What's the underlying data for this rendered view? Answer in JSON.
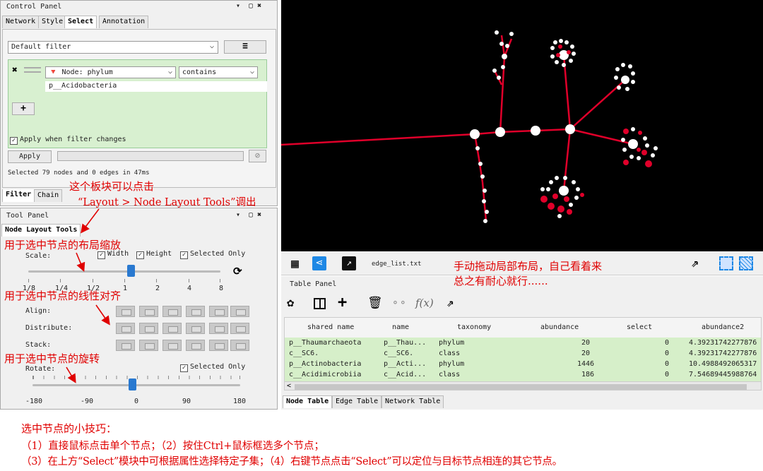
{
  "control_panel": {
    "title": "Control Panel",
    "tabs": [
      "Network",
      "Style",
      "Select",
      "Annotation"
    ],
    "filter_select": "Default filter",
    "node_field": "Node: phylum",
    "condition": "contains",
    "filter_value": "p__Acidobacteria",
    "apply_when_changes": "Apply when filter changes",
    "apply_label": "Apply",
    "status": "Selected 79 nodes and 0 edges in 47ms",
    "bottom_tabs": [
      "Filter",
      "Chain"
    ]
  },
  "tool_panel": {
    "title": "Tool Panel",
    "tab": "Node Layout Tools",
    "scale_label": "Scale:",
    "width_label": "Width",
    "height_label": "Height",
    "selected_only": "Selected Only",
    "scale_ticks": [
      "1/8",
      "1/4",
      "1/2",
      "1",
      "2",
      "4",
      "8"
    ],
    "scale_value": 1,
    "align_label": "Align:",
    "distribute_label": "Distribute:",
    "stack_label": "Stack:",
    "rotate_label": "Rotate:",
    "rotate_selected_only": "Selected Only",
    "rotate_ticks": [
      "-180",
      "-90",
      "0",
      "90",
      "180"
    ],
    "rotate_value": 0
  },
  "annotations": {
    "a1_line1": "这个板块可以点击",
    "a1_line2": "“Layout > Node Layout Tools”调出",
    "a2": "用于选中节点的布局缩放",
    "a3": "用于选中节点的线性对齐",
    "a4": "用于选中节点的旋转",
    "a5_line1": "手动拖动局部布局，自己看着来",
    "a5_line2": "总之有耐心就行......"
  },
  "toolbar": {
    "filename": "edge_list.txt"
  },
  "table_panel": {
    "title": "Table Panel",
    "fx": "f(x)",
    "columns": [
      "shared name",
      "name",
      "taxonomy",
      "abundance",
      "select",
      "abundance2"
    ],
    "rows": [
      [
        "p__Thaumarchaeota",
        "p__Thau...",
        "phylum",
        "20",
        "0",
        "4.39231742277876"
      ],
      [
        "c__SC6.",
        "c__SC6.",
        "class",
        "20",
        "0",
        "4.39231742277876"
      ],
      [
        "p__Actinobacteria",
        "p__Acti...",
        "phylum",
        "1446",
        "0",
        "10.4988492065317"
      ],
      [
        "c__Acidimicrobiia",
        "c__Acid...",
        "class",
        "186",
        "0",
        "7.54689445988764"
      ]
    ],
    "bottom_tabs": [
      "Node Table",
      "Edge Table",
      "Network Table"
    ]
  },
  "tips": {
    "title": "选中节点的小技巧：",
    "line1": "（1）直接鼠标点击单个节点；（2）按住Ctrl+鼠标框选多个节点；",
    "line2": "（3）在上方“Select”模块中可根据属性选择特定子集；（4）右键节点点击“Select”可以定位与目标节点相连的其它节点。"
  },
  "colors": {
    "annotation": "#e00000",
    "filter_bg": "#d8f0d0",
    "network_bg": "#000000",
    "edge": "#e0002a",
    "table_row": "#d6efc9"
  }
}
